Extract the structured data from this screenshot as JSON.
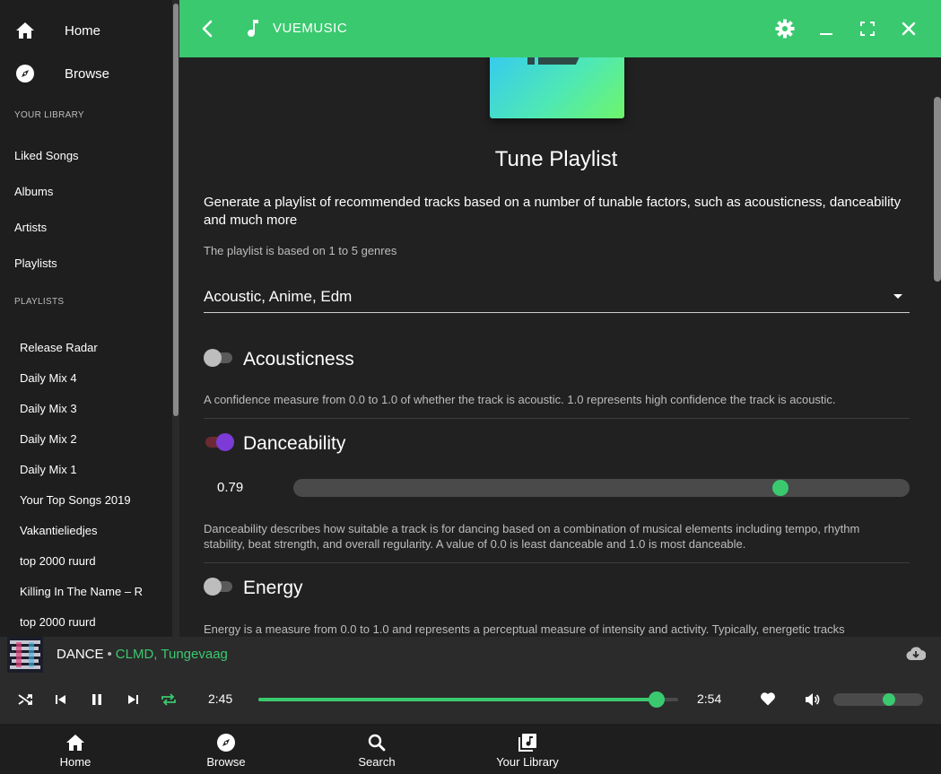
{
  "sidebar": {
    "nav": [
      {
        "label": "Home",
        "icon": "home-icon"
      },
      {
        "label": "Browse",
        "icon": "compass-icon"
      }
    ],
    "library_header": "YOUR LIBRARY",
    "library": [
      "Liked Songs",
      "Albums",
      "Artists",
      "Playlists"
    ],
    "playlists_header": "PLAYLISTS",
    "playlists": [
      "Release Radar",
      "Daily Mix 4",
      "Daily Mix 3",
      "Daily Mix 2",
      "Daily Mix 1",
      "Your Top Songs 2019",
      "Vakantieliedjes",
      "top 2000 ruurd",
      "Killing In The Name – R",
      "top 2000 ruurd"
    ]
  },
  "topbar": {
    "title": "VUEMUSIC",
    "accent": "#3ac96f",
    "icons": [
      "back-icon",
      "music-note-icon",
      "gear-icon",
      "minimize-icon",
      "maximize-icon",
      "close-icon"
    ]
  },
  "main": {
    "heading": "Tune Playlist",
    "description": "Generate a playlist of recommended tracks based on a number of tunable factors, such as acousticness, danceability and much more",
    "note": "The playlist is based on 1 to 5 genres",
    "genres_value": "Acoustic, Anime, Edm",
    "features": [
      {
        "title": "Acousticness",
        "enabled": false,
        "description": "A confidence measure from 0.0 to 1.0 of whether the track is acoustic. 1.0 represents high confidence the track is acoustic."
      },
      {
        "title": "Danceability",
        "enabled": true,
        "value": "0.79",
        "slider_fraction": 0.79,
        "description": "Danceability describes how suitable a track is for dancing based on a combination of musical elements including tempo, rhythm stability, beat strength, and overall regularity. A value of 0.0 is least danceable and 1.0 is most danceable."
      },
      {
        "title": "Energy",
        "enabled": false,
        "description": "Energy is a measure from 0.0 to 1.0 and represents a perceptual measure of intensity and activity. Typically, energetic tracks"
      }
    ]
  },
  "player": {
    "track": "DANCE",
    "separator": "•",
    "artists": [
      "CLMD",
      "Tungevaag"
    ],
    "artist_separator": ", ",
    "elapsed": "2:45",
    "duration": "2:54",
    "progress_fraction": 0.948,
    "volume_fraction": 0.62
  },
  "bottomnav": [
    {
      "label": "Home",
      "icon": "home-icon"
    },
    {
      "label": "Browse",
      "icon": "compass-icon"
    },
    {
      "label": "Search",
      "icon": "search-icon"
    },
    {
      "label": "Your Library",
      "icon": "library-icon"
    }
  ]
}
